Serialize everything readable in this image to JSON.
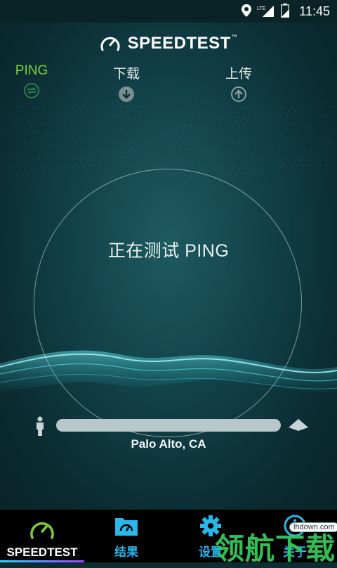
{
  "status_bar": {
    "time": "11:45",
    "icons": [
      "location-icon",
      "lte-signal-icon",
      "battery-icon"
    ],
    "network_label": "LTE"
  },
  "header": {
    "logo_text": "SPEEDTEST",
    "trademark": "™"
  },
  "metrics": {
    "ping": {
      "label": "PING",
      "icon": "ping-icon",
      "color": "#7fce3a"
    },
    "download": {
      "label": "下载",
      "icon": "download-icon"
    },
    "upload": {
      "label": "上传",
      "icon": "upload-icon"
    }
  },
  "gauge": {
    "status_text": "正在测试 PING"
  },
  "server": {
    "location": "Palo Alto, CA",
    "progress": 0
  },
  "tabs": [
    {
      "label": "SPEEDTEST",
      "icon": "speedometer-icon",
      "active": true
    },
    {
      "label": "结果",
      "icon": "results-folder-icon",
      "active": false
    },
    {
      "label": "设置",
      "icon": "gear-icon",
      "active": false
    },
    {
      "label": "关于",
      "icon": "info-icon",
      "active": false
    }
  ],
  "watermark": {
    "text": "领航下载",
    "url": "lhdown.com"
  },
  "colors": {
    "accent_green": "#7fce3a",
    "tab_blue": "#27b7e8",
    "wave_cyan": "#3ee0e8"
  }
}
